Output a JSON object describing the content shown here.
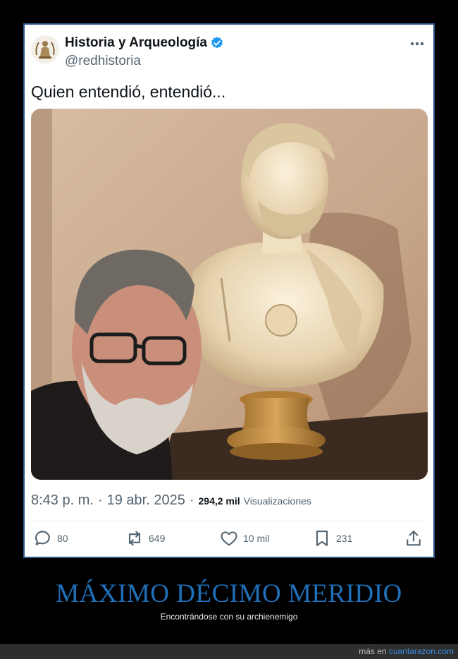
{
  "tweet": {
    "display_name": "Historia y Arqueología",
    "handle": "@redhistoria",
    "text": "Quien entendió, entendió...",
    "time": "8:43 p. m.",
    "date": "19 abr. 2025",
    "dot": "·",
    "views_count": "294,2 mil",
    "views_label": "Visualizaciones",
    "verified_color": "#1d9bf0",
    "actions": {
      "replies": "80",
      "retweets": "649",
      "likes": "10 mil",
      "bookmarks": "231"
    }
  },
  "caption": {
    "headline": "MÁXIMO DÉCIMO MERIDIO",
    "subhead": "Encontrándose con su archienemigo"
  },
  "footer": {
    "prefix": "más en",
    "site": "cuantarazon.com"
  },
  "icons": [
    "avatar-emblem-icon",
    "verified-badge-icon",
    "more-icon",
    "reply-icon",
    "retweet-icon",
    "like-icon",
    "bookmark-icon",
    "share-icon"
  ]
}
